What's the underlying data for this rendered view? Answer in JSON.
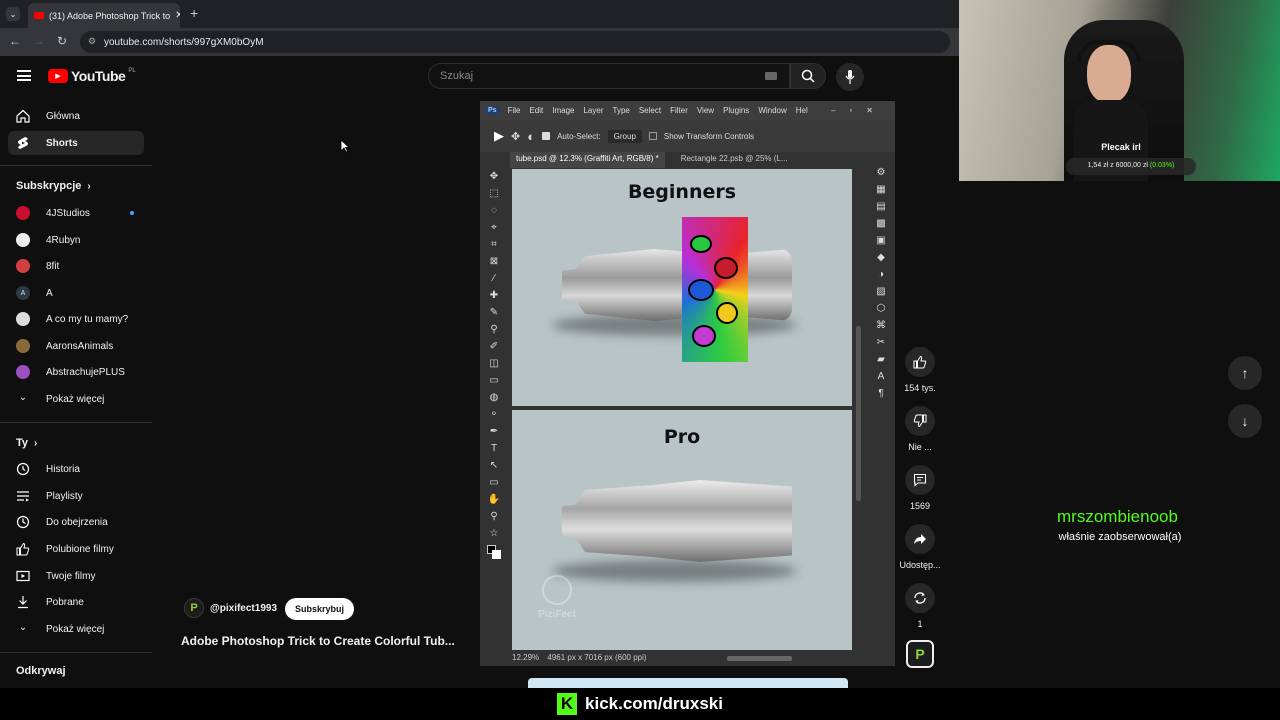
{
  "browser": {
    "tab_title": "(31) Adobe Photoshop Trick to",
    "url": "youtube.com/shorts/997gXM0bOyM"
  },
  "youtube": {
    "logo_text": "YouTube",
    "region": "PL",
    "search_placeholder": "Szukaj"
  },
  "sidebar": {
    "main": [
      {
        "label": "Główna",
        "icon": "home-icon"
      },
      {
        "label": "Shorts",
        "icon": "shorts-icon"
      }
    ],
    "subscriptions_title": "Subskrypcje",
    "subscriptions": [
      {
        "label": "4JStudios",
        "color": "#c8102e"
      },
      {
        "label": "4Rubyn",
        "color": "#eeeeee"
      },
      {
        "label": "8fit",
        "color": "#d04040"
      },
      {
        "label": "A",
        "color": "#2b3a44"
      },
      {
        "label": "A co my tu mamy?",
        "color": "#dddddd"
      },
      {
        "label": "AaronsAnimals",
        "color": "#8a6a3a"
      },
      {
        "label": "AbstrachujePLUS",
        "color": "#9b4fc0"
      }
    ],
    "show_more_1": "Pokaż więcej",
    "you_title": "Ty",
    "you": [
      {
        "label": "Historia",
        "icon": "history-icon"
      },
      {
        "label": "Playlisty",
        "icon": "playlist-icon"
      },
      {
        "label": "Do obejrzenia",
        "icon": "watch-later-icon"
      },
      {
        "label": "Polubione filmy",
        "icon": "like-icon"
      },
      {
        "label": "Twoje filmy",
        "icon": "video-icon"
      },
      {
        "label": "Pobrane",
        "icon": "download-icon"
      }
    ],
    "show_more_2": "Pokaż więcej",
    "explore_title": "Odkrywaj"
  },
  "short": {
    "channel": "@pixifect1993",
    "subscribe": "Subskrybuj",
    "title": "Adobe Photoshop Trick to Create Colorful Tub...",
    "likes": "154 tys.",
    "dislike": "Nie ...",
    "comments": "1569",
    "share": "Udostęp...",
    "remix": "1"
  },
  "photoshop": {
    "menu": [
      "File",
      "Edit",
      "Image",
      "Layer",
      "Type",
      "Select",
      "Filter",
      "View",
      "Plugins",
      "Window",
      "Hel"
    ],
    "options": {
      "auto_select": "Auto-Select:",
      "group": "Group",
      "transform": "Show Transform Controls"
    },
    "tab_active": "tube.psd @ 12.3% (Graffiti Art, RGB/8) *",
    "tab_inactive": "Rectangle 22.psb @ 25% (L...",
    "canvas_top_title": "Beginners",
    "canvas_bottom_title": "Pro",
    "watermark": "PiziFect",
    "status_zoom": "12.29%",
    "status_info": "4961 px x 7016 px (600 ppi)"
  },
  "stream": {
    "goal_title": "Plecak irl",
    "goal_text": "1,54 zł z 6000,00 zł",
    "goal_pct": "(0.03%)",
    "follower_name": "mrszombienoob",
    "follower_text": "właśnie zaobserwował(a)",
    "kick_url": "kick.com/druxski"
  }
}
